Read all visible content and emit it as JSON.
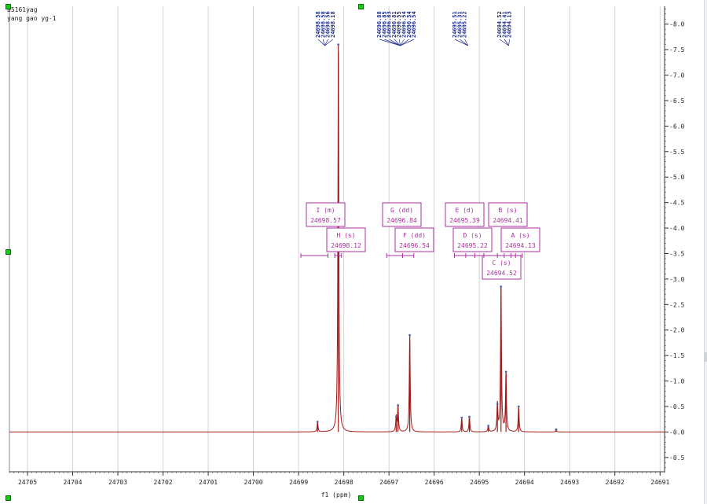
{
  "header": {
    "line1": "85161yag",
    "line2": "yang gao  yg-1"
  },
  "chart_data": {
    "type": "line",
    "xlabel": "f1 (ppm)",
    "x_reversed": true,
    "xlim": [
      24705.4,
      24690.9
    ],
    "ylim": [
      -0.78,
      8.35
    ],
    "x_ticks": [
      24705,
      24704,
      24703,
      24702,
      24701,
      24700,
      24699,
      24698,
      24697,
      24696,
      24695,
      24694,
      24693,
      24692,
      24691
    ],
    "y_ticks": [
      8.0,
      7.5,
      7.0,
      6.5,
      6.0,
      5.5,
      5.0,
      4.5,
      4.0,
      3.5,
      3.0,
      2.5,
      2.0,
      1.5,
      1.0,
      0.5,
      0.0,
      -0.5
    ],
    "peak_labels": [
      "24698.58",
      "24698.58",
      "24698.56",
      "24698.18",
      "24696.88",
      "24696.85",
      "24696.83",
      "24696.81",
      "24696.55",
      "24696.54",
      "24696.54",
      "24696.54",
      "24695.51",
      "24695.31",
      "24695.22",
      "24694.52",
      "24694.41",
      "24694.13"
    ],
    "peaks": [
      {
        "x": 24698.58,
        "y": 0.2
      },
      {
        "x": 24698.12,
        "y": 7.6
      },
      {
        "x": 24696.84,
        "y": 0.3
      },
      {
        "x": 24696.8,
        "y": 0.52
      },
      {
        "x": 24696.54,
        "y": 1.9
      },
      {
        "x": 24695.39,
        "y": 0.28
      },
      {
        "x": 24695.22,
        "y": 0.3
      },
      {
        "x": 24694.8,
        "y": 0.12
      },
      {
        "x": 24694.6,
        "y": 0.55
      },
      {
        "x": 24694.52,
        "y": 2.85
      },
      {
        "x": 24694.41,
        "y": 1.18
      },
      {
        "x": 24694.13,
        "y": 0.5
      },
      {
        "x": 24693.3,
        "y": 0.05
      }
    ],
    "multiplets": [
      {
        "name": "I (m)",
        "value": "24698.57",
        "range": [
          24698.95,
          24698.35
        ]
      },
      {
        "name": "H (s)",
        "value": "24698.12",
        "range": [
          24698.2,
          24698.05
        ]
      },
      {
        "name": "G (dd)",
        "value": "24696.84",
        "range": [
          24697.05,
          24696.7
        ]
      },
      {
        "name": "F (dd)",
        "value": "24696.54",
        "range": [
          24696.7,
          24696.45
        ]
      },
      {
        "name": "E (d)",
        "value": "24695.39",
        "range": [
          24695.55,
          24695.1
        ]
      },
      {
        "name": "D (s)",
        "value": "24695.22",
        "range": [
          24695.3,
          24694.9
        ]
      },
      {
        "name": "C (s)",
        "value": "24694.52",
        "range": [
          24694.6,
          24694.45
        ]
      },
      {
        "name": "B (s)",
        "value": "24694.41",
        "range": [
          24694.9,
          24694.3
        ]
      },
      {
        "name": "A (s)",
        "value": "24694.13",
        "range": [
          24694.2,
          24694.05
        ]
      }
    ],
    "colors": {
      "spectrum": "#a01818",
      "peak_label": "#1f2f8a",
      "multiplet": "#a8329f",
      "axis": "#333333",
      "grid": "#d2d2d2",
      "handle": "#12cc12"
    }
  }
}
